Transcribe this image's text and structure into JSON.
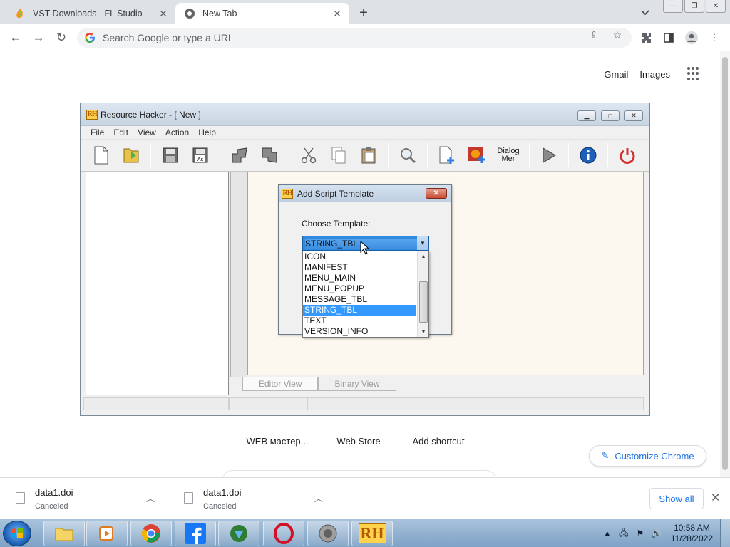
{
  "browser": {
    "tabs": [
      {
        "title": "VST Downloads - FL Studio",
        "active": false
      },
      {
        "title": "New Tab",
        "active": true
      }
    ],
    "omnibox_placeholder": "Search Google or type a URL"
  },
  "ntp": {
    "links": [
      "Gmail",
      "Images"
    ],
    "shortcuts": [
      "WEB мастер...",
      "Web Store",
      "Add shortcut"
    ],
    "customize_label": "Customize Chrome"
  },
  "resource_hacker": {
    "title": "Resource Hacker - [ New ]",
    "menu": [
      "File",
      "Edit",
      "View",
      "Action",
      "Help"
    ],
    "toolbar": [
      "new-file",
      "open",
      "save",
      "save-as",
      "compile",
      "export",
      "cut",
      "copy",
      "paste",
      "find",
      "add-resource",
      "add-image",
      "dialog-menu",
      "run-script",
      "info",
      "exit"
    ],
    "dialog_menu_label": [
      "Dialog",
      "Mer"
    ],
    "tabs": [
      "Editor View",
      "Binary View"
    ]
  },
  "dialog": {
    "title": "Add Script Template",
    "label": "Choose Template:",
    "selected": "STRING_TBL",
    "options": [
      "ICON",
      "MANIFEST",
      "MENU_MAIN",
      "MENU_POPUP",
      "MESSAGE_TBL",
      "STRING_TBL",
      "TEXT",
      "VERSION_INFO"
    ]
  },
  "downloads": [
    {
      "name": "data1.doi",
      "status": "Canceled"
    },
    {
      "name": "data1.doi",
      "status": "Canceled"
    }
  ],
  "downloads_show_all": "Show all",
  "taskbar": {
    "apps": [
      "explorer",
      "media-player",
      "chrome",
      "facebook",
      "idm",
      "opera",
      "speaker",
      "resource-hacker"
    ],
    "time": "10:58 AM",
    "date": "11/28/2022"
  },
  "colors": {
    "accent": "#1a73e8",
    "selection": "#3399ff",
    "editor_bg": "#fdf8ef"
  }
}
